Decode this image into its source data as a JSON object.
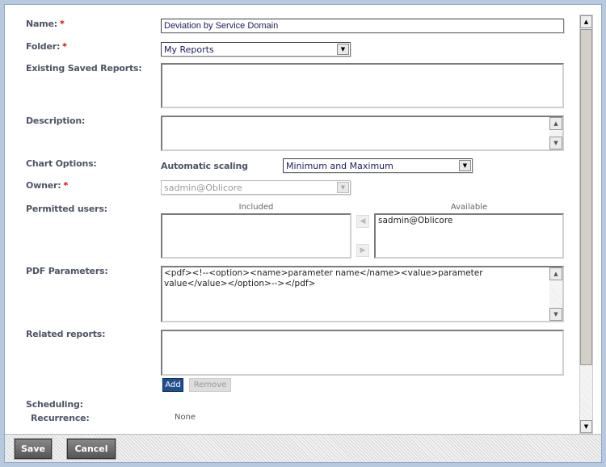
{
  "form": {
    "name_label": "Name:",
    "name_value": "Deviation by Service Domain",
    "folder_label": "Folder:",
    "folder_value": "My Reports",
    "existing_label": "Existing Saved Reports:",
    "description_label": "Description:",
    "chart_label": "Chart Options:",
    "auto_scaling_label": "Automatic scaling",
    "auto_scaling_value": "Minimum and Maximum",
    "owner_label": "Owner:",
    "owner_value": "sadmin@Oblicore",
    "permitted_label": "Permitted users:",
    "included_label": "Included",
    "available_label": "Available",
    "available_items": [
      "sadmin@Oblicore"
    ],
    "pdf_label": "PDF Parameters:",
    "pdf_value": "<pdf><!--<option><name>parameter name</name><value>parameter value</value></option>--></pdf>",
    "related_label": "Related reports:",
    "add_label": "Add",
    "remove_label": "Remove",
    "scheduling_label": "Scheduling:",
    "recurrence_label": "Recurrence:",
    "recurrence_value": "None",
    "required_mark": "*"
  },
  "footer": {
    "save_label": "Save",
    "cancel_label": "Cancel"
  },
  "colors": {
    "required": "#e00000",
    "add_button": "#1f4f8f"
  }
}
